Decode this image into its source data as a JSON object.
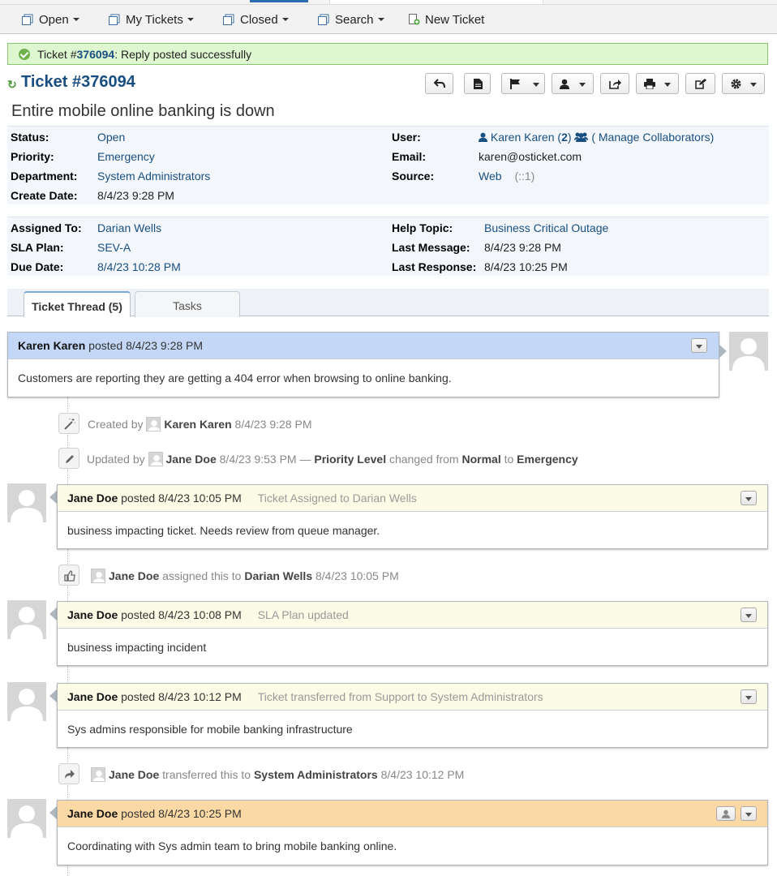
{
  "nav": {
    "items": [
      {
        "label": "Open",
        "dropdown": true,
        "icon": "tickets-icon"
      },
      {
        "label": "My Tickets",
        "dropdown": true,
        "icon": "tickets-icon"
      },
      {
        "label": "Closed",
        "dropdown": true,
        "icon": "tickets-icon"
      },
      {
        "label": "Search",
        "dropdown": true,
        "icon": "tickets-icon"
      },
      {
        "label": "New Ticket",
        "dropdown": false,
        "icon": "new-ticket-icon"
      }
    ]
  },
  "message": {
    "prefix": "Ticket #",
    "ticket_number": "376094",
    "suffix": ": Reply posted successfully"
  },
  "ticket": {
    "title": "Ticket #376094",
    "subject": "Entire mobile online banking is down"
  },
  "toolbar": {
    "buttons": [
      "reply-icon",
      "print-pdf-icon",
      "flag-icon",
      "assign-user-icon",
      "transfer-icon",
      "print-icon",
      "edit-icon",
      "settings-icon"
    ]
  },
  "info1": {
    "status_label": "Status:",
    "status": "Open",
    "priority_label": "Priority:",
    "priority": "Emergency",
    "department_label": "Department:",
    "department": "System Administrators",
    "create_date_label": "Create Date:",
    "create_date": "8/4/23 9:28 PM",
    "user_label": "User:",
    "user": "Karen Karen",
    "user_count": "2",
    "manage_collaborators": "( Manage Collaborators)",
    "email_label": "Email:",
    "email": "karen@osticket.com",
    "source_label": "Source:",
    "source": "Web",
    "source_ip": "(::1)"
  },
  "info2": {
    "assigned_label": "Assigned To:",
    "assigned": "Darian Wells",
    "sla_label": "SLA Plan:",
    "sla": "SEV-A",
    "due_label": "Due Date:",
    "due": "8/4/23 10:28 PM",
    "help_topic_label": "Help Topic:",
    "help_topic": "Business Critical Outage",
    "last_message_label": "Last Message:",
    "last_message": "8/4/23 9:28 PM",
    "last_response_label": "Last Response:",
    "last_response": "8/4/23 10:25 PM"
  },
  "tabs": {
    "thread": "Ticket Thread (5)",
    "tasks": "Tasks"
  },
  "thread": {
    "e1": {
      "who": "Karen Karen",
      "posted": "posted 8/4/23 9:28 PM",
      "body": "Customers are reporting they are getting a 404 error when browsing to online banking."
    },
    "ev1": {
      "pre": "Created by",
      "who": "Karen Karen",
      "time": "8/4/23 9:28 PM"
    },
    "ev2": {
      "pre": "Updated by",
      "who": "Jane Doe",
      "time": "8/4/23 9:53 PM —",
      "field": "Priority Level",
      "mid": "changed from",
      "from": "Normal",
      "to_word": "to",
      "to": "Emergency"
    },
    "e2": {
      "who": "Jane Doe",
      "posted": "posted 8/4/23 10:05 PM",
      "note": "Ticket Assigned to Darian Wells",
      "body": "business impacting ticket. Needs review from queue manager."
    },
    "ev3": {
      "who": "Jane Doe",
      "mid": "assigned this to",
      "target": "Darian Wells",
      "time": "8/4/23 10:05 PM"
    },
    "e3": {
      "who": "Jane Doe",
      "posted": "posted 8/4/23 10:08 PM",
      "note": "SLA Plan updated",
      "body": "business impacting incident"
    },
    "e4": {
      "who": "Jane Doe",
      "posted": "posted 8/4/23 10:12 PM",
      "note": "Ticket transferred from Support to System Administrators",
      "body": "Sys admins responsible for mobile banking infrastructure"
    },
    "ev4": {
      "who": "Jane Doe",
      "mid": "transferred this to",
      "target": "System Administrators",
      "time": "8/4/23 10:12 PM"
    },
    "e5": {
      "who": "Jane Doe",
      "posted": "posted 8/4/23 10:25 PM",
      "body": "Coordinating with Sys admin team to bring mobile banking online."
    }
  }
}
